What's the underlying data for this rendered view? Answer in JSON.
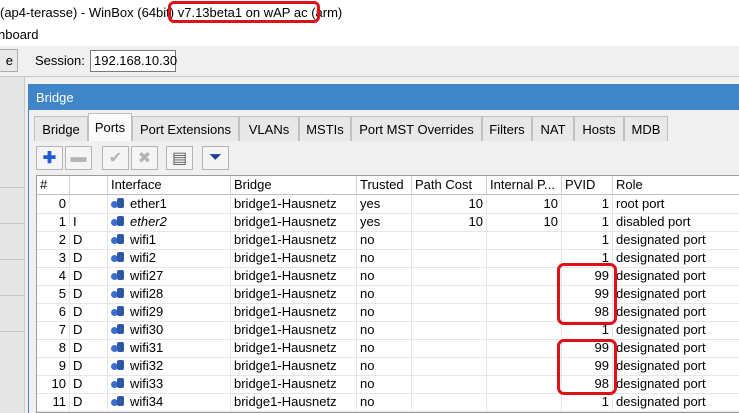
{
  "titlebar": {
    "prefix": "(ap4-terasse) - WinBox (64bit) ",
    "version": "v7.13beta1 on wAP ac (arm)"
  },
  "menubar": {
    "label": "nboard"
  },
  "toolbar": {
    "cut_button": "e",
    "session_label": "Session:",
    "session_value": "192.168.10.30"
  },
  "window": {
    "title": "Bridge",
    "tabs": [
      {
        "label": "Bridge"
      },
      {
        "label": "Ports",
        "active": true
      },
      {
        "label": "Port Extensions"
      },
      {
        "label": "VLANs"
      },
      {
        "label": "MSTIs"
      },
      {
        "label": "Port MST Overrides"
      },
      {
        "label": "Filters"
      },
      {
        "label": "NAT"
      },
      {
        "label": "Hosts"
      },
      {
        "label": "MDB"
      }
    ],
    "tools": [
      {
        "icon": "plus-icon",
        "glyph": "✚"
      },
      {
        "icon": "minus-icon",
        "glyph": "▬"
      },
      {
        "icon": "check-icon",
        "glyph": "✔"
      },
      {
        "icon": "cross-icon",
        "glyph": "✖"
      },
      {
        "icon": "comment-icon",
        "glyph": "▤"
      },
      {
        "icon": "filter-icon",
        "glyph": "⏷"
      }
    ],
    "columns": [
      "#",
      "",
      "Interface",
      "Bridge",
      "Trusted",
      "Path Cost",
      "Internal P...",
      "PVID",
      "Role"
    ],
    "rows": [
      {
        "num": "0",
        "flag": "",
        "iface": "ether1",
        "bridge": "bridge1-Hausnetz",
        "trusted": "yes",
        "path_cost": "10",
        "internal": "10",
        "pvid": "1",
        "role": "root port"
      },
      {
        "num": "1",
        "flag": "I",
        "iface": "ether2",
        "bridge": "bridge1-Hausnetz",
        "trusted": "yes",
        "path_cost": "10",
        "internal": "10",
        "pvid": "1",
        "role": "disabled port"
      },
      {
        "num": "2",
        "flag": "D",
        "iface": "wifi1",
        "bridge": "bridge1-Hausnetz",
        "trusted": "no",
        "path_cost": "",
        "internal": "",
        "pvid": "1",
        "role": "designated port"
      },
      {
        "num": "3",
        "flag": "D",
        "iface": "wifi2",
        "bridge": "bridge1-Hausnetz",
        "trusted": "no",
        "path_cost": "",
        "internal": "",
        "pvid": "1",
        "role": "designated port"
      },
      {
        "num": "4",
        "flag": "D",
        "iface": "wifi27",
        "bridge": "bridge1-Hausnetz",
        "trusted": "no",
        "path_cost": "",
        "internal": "",
        "pvid": "99",
        "role": "designated port"
      },
      {
        "num": "5",
        "flag": "D",
        "iface": "wifi28",
        "bridge": "bridge1-Hausnetz",
        "trusted": "no",
        "path_cost": "",
        "internal": "",
        "pvid": "99",
        "role": "designated port"
      },
      {
        "num": "6",
        "flag": "D",
        "iface": "wifi29",
        "bridge": "bridge1-Hausnetz",
        "trusted": "no",
        "path_cost": "",
        "internal": "",
        "pvid": "98",
        "role": "designated port"
      },
      {
        "num": "7",
        "flag": "D",
        "iface": "wifi30",
        "bridge": "bridge1-Hausnetz",
        "trusted": "no",
        "path_cost": "",
        "internal": "",
        "pvid": "1",
        "role": "designated port"
      },
      {
        "num": "8",
        "flag": "D",
        "iface": "wifi31",
        "bridge": "bridge1-Hausnetz",
        "trusted": "no",
        "path_cost": "",
        "internal": "",
        "pvid": "99",
        "role": "designated port"
      },
      {
        "num": "9",
        "flag": "D",
        "iface": "wifi32",
        "bridge": "bridge1-Hausnetz",
        "trusted": "no",
        "path_cost": "",
        "internal": "",
        "pvid": "99",
        "role": "designated port"
      },
      {
        "num": "10",
        "flag": "D",
        "iface": "wifi33",
        "bridge": "bridge1-Hausnetz",
        "trusted": "no",
        "path_cost": "",
        "internal": "",
        "pvid": "98",
        "role": "designated port"
      },
      {
        "num": "11",
        "flag": "D",
        "iface": "wifi34",
        "bridge": "bridge1-Hausnetz",
        "trusted": "no",
        "path_cost": "",
        "internal": "",
        "pvid": "1",
        "role": "designated port"
      }
    ]
  },
  "colors": {
    "highlight": "#e0101a",
    "title_bar": "#3f86c8",
    "icon_blue": "#2f57a8"
  }
}
